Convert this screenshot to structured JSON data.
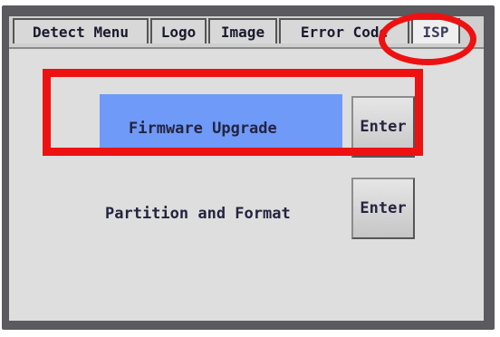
{
  "tabs": [
    {
      "label": "Detect Menu"
    },
    {
      "label": "Logo"
    },
    {
      "label": "Image"
    },
    {
      "label": "Error Code"
    },
    {
      "label": "ISP"
    }
  ],
  "rows": [
    {
      "label": "Firmware Upgrade",
      "button": "Enter",
      "highlighted": true
    },
    {
      "label": "Partition and Format",
      "button": "Enter",
      "highlighted": false
    }
  ],
  "colors": {
    "highlight": "#6f9af8",
    "annotation": "#ee1111"
  }
}
